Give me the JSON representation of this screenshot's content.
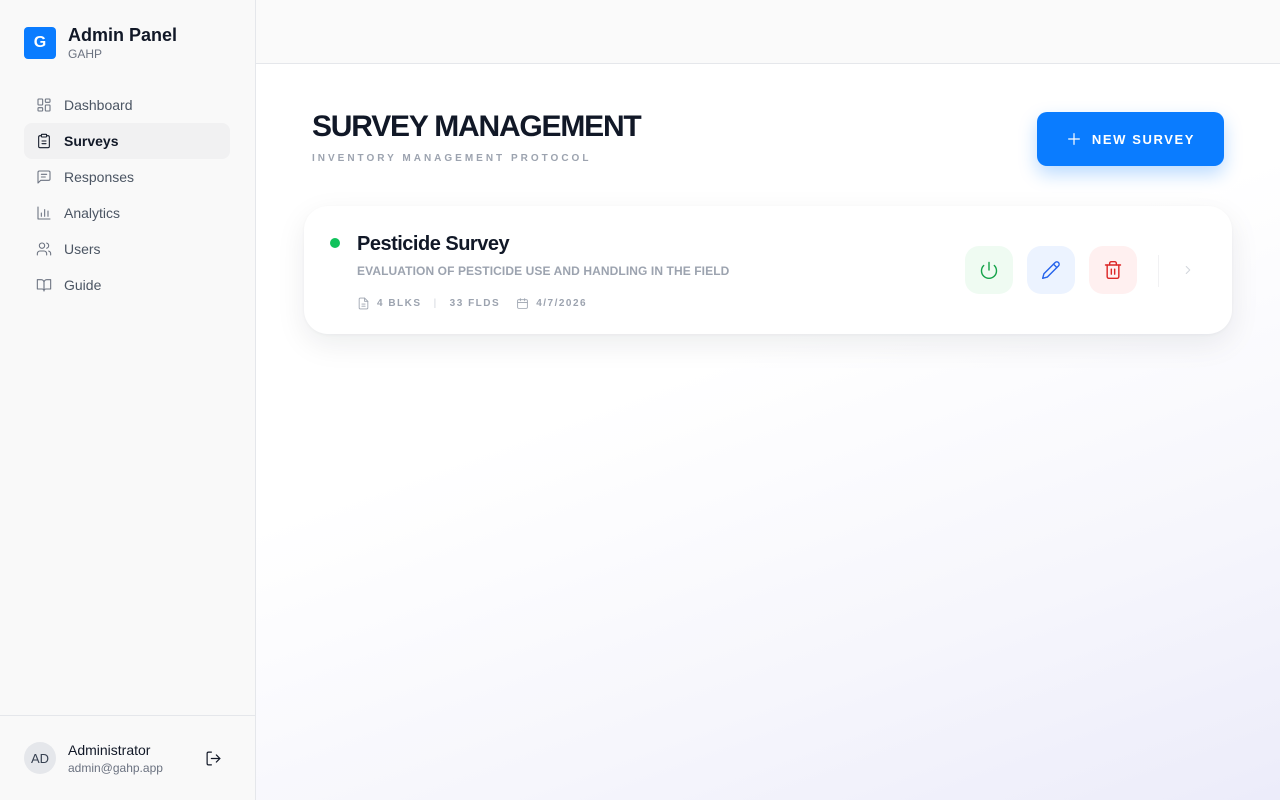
{
  "brand": {
    "logo_letter": "G",
    "title": "Admin Panel",
    "subtitle": "GAHP",
    "accent_color": "#0a7cff"
  },
  "sidebar": {
    "items": [
      {
        "label": "Dashboard",
        "icon": "dashboard-icon",
        "active": false
      },
      {
        "label": "Surveys",
        "icon": "clipboard-icon",
        "active": true
      },
      {
        "label": "Responses",
        "icon": "message-icon",
        "active": false
      },
      {
        "label": "Analytics",
        "icon": "bar-chart-icon",
        "active": false
      },
      {
        "label": "Users",
        "icon": "users-icon",
        "active": false
      },
      {
        "label": "Guide",
        "icon": "book-icon",
        "active": false
      }
    ]
  },
  "user": {
    "initials": "AD",
    "name": "Administrator",
    "email": "admin@gahp.app"
  },
  "header": {
    "title": "SURVEY MANAGEMENT",
    "subtitle": "INVENTORY MANAGEMENT PROTOCOL",
    "new_button_label": "NEW SURVEY"
  },
  "surveys": [
    {
      "title": "Pesticide Survey",
      "description": "EVALUATION OF PESTICIDE USE AND HANDLING IN THE FIELD",
      "status_color": "#10c25b",
      "blocks": "4 BLKS",
      "fields": "33 FLDS",
      "separator": "|",
      "date": "4/7/2026"
    }
  ]
}
